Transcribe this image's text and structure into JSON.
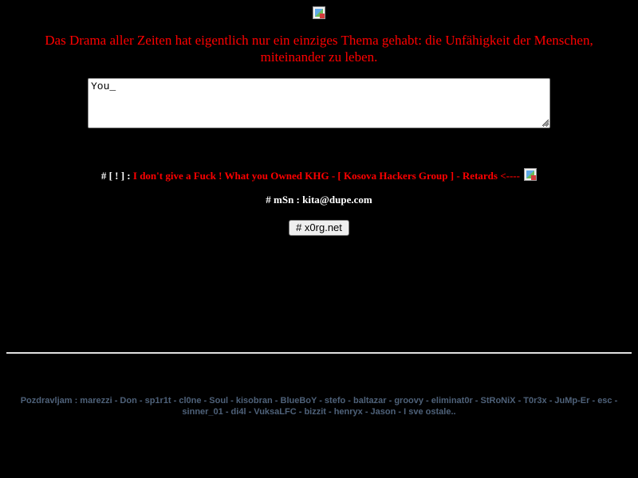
{
  "quote": {
    "text": "Das Drama aller Zeiten hat eigentlich nur ein einziges Thema gehabt: die Unfähigkeit der Menschen, miteinander zu leben."
  },
  "textarea": {
    "value": "You_"
  },
  "notice": {
    "prefix": "# [ ! ] :",
    "message": "I don't give a Fuck ! What you Owned KHG - [ Kosova Hackers Group ] - Retards <----"
  },
  "msn": {
    "text": "# mSn : kita@dupe.com"
  },
  "button": {
    "label": "# x0rg.net"
  },
  "greetings": {
    "text": "Pozdravljam : marezzi - Don - sp1r1t - cl0ne - Soul - kisobran - BlueBoY - stefo - baltazar - groovy - eliminat0r - StRoNiX - T0r3x - JuMp-Er - esc - sinner_01 - di4l - VuksaLFC - bizzit - henryx - Jason - I sve ostale.."
  },
  "colors": {
    "background": "#000000",
    "quote": "#ff0000",
    "notice_message": "#ff0000",
    "label_text": "#ffffff",
    "greetings": "#4e6179",
    "divider": "#e0e0e0"
  },
  "icons": {
    "top_image": "broken-image-icon",
    "notice_image": "broken-image-icon"
  }
}
